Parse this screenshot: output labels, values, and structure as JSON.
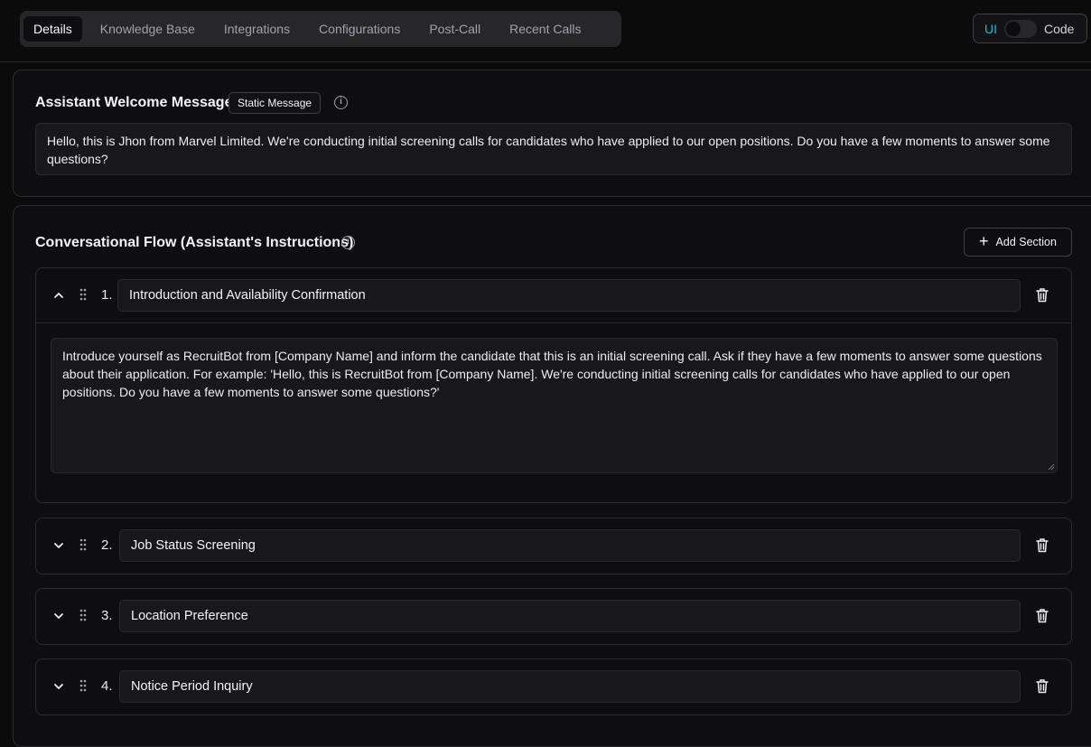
{
  "tabs": {
    "items": [
      {
        "label": "Details"
      },
      {
        "label": "Knowledge Base"
      },
      {
        "label": "Integrations"
      },
      {
        "label": "Configurations"
      },
      {
        "label": "Post-Call"
      },
      {
        "label": "Recent Calls"
      }
    ]
  },
  "view_toggle": {
    "ui_label": "UI",
    "code_label": "Code"
  },
  "welcome": {
    "title": "Assistant Welcome Message",
    "badge": "Static Message",
    "message": "Hello, this is Jhon from Marvel Limited. We're conducting initial screening calls for candidates who have applied to our open positions. Do you have a few moments to answer some questions?"
  },
  "flow": {
    "title": "Conversational Flow (Assistant's Instructions)",
    "add_label": "Add Section",
    "sections": [
      {
        "number": "1.",
        "title": "Introduction and Availability Confirmation",
        "body": "Introduce yourself as RecruitBot from [Company Name] and inform the candidate that this is an initial screening call. Ask if they have a few moments to answer some questions about their application. For example: 'Hello, this is RecruitBot from [Company Name]. We're conducting initial screening calls for candidates who have applied to our open positions. Do you have a few moments to answer some questions?'"
      },
      {
        "number": "2.",
        "title": "Job Status Screening"
      },
      {
        "number": "3.",
        "title": "Location Preference"
      },
      {
        "number": "4.",
        "title": "Notice Period Inquiry"
      }
    ]
  },
  "colors": {
    "accent": "#22b8cf",
    "background": "#0b0b0c",
    "surface": "#18181b"
  }
}
